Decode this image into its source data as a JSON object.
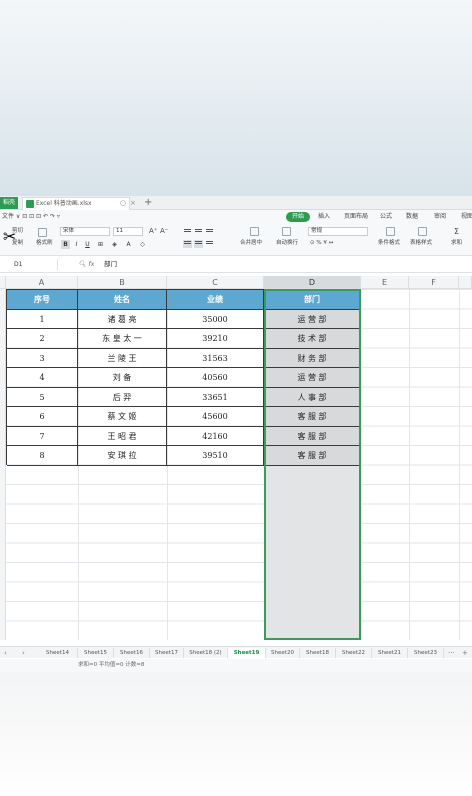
{
  "titlebar": {
    "app_tab": "稻壳",
    "file_tab": "Excel 科普动画.xlsx",
    "new_tab_symbol": "+"
  },
  "menubar": {
    "left_items": "文件 ∨ ⊡ ⊡ ⊡ ↶ ↷ ▿",
    "tabs": [
      {
        "label": "开始",
        "active": true
      },
      {
        "label": "插入",
        "active": false
      },
      {
        "label": "页面布局",
        "active": false
      },
      {
        "label": "公式",
        "active": false
      },
      {
        "label": "数据",
        "active": false
      },
      {
        "label": "审阅",
        "active": false
      },
      {
        "label": "视图",
        "active": false
      }
    ]
  },
  "ribbon": {
    "cut": "剪切",
    "paste": "粘贴",
    "copy": "复制",
    "format_painter": "格式刷",
    "font_name": "宋体",
    "font_size": "11",
    "bold": "B",
    "italic": "I",
    "underline": "U",
    "merge_center": "合并居中",
    "wrap_text": "自动换行",
    "number_format": "常规",
    "conditional_format": "条件格式",
    "table_style": "表格样式",
    "sum": "求和"
  },
  "formula_bar": {
    "cell_ref": "D1",
    "fx_label": "fx",
    "value": "部门"
  },
  "columns": [
    "A",
    "B",
    "C",
    "D",
    "E",
    "F"
  ],
  "selected_column": "D",
  "table": {
    "headers": [
      "序号",
      "姓名",
      "业绩",
      "部门"
    ],
    "rows": [
      [
        "1",
        "诸  葛  亮",
        "35000",
        "运  营  部"
      ],
      [
        "2",
        "东 皇 太 一",
        "39210",
        "技  术  部"
      ],
      [
        "3",
        "兰  陵  王",
        "31563",
        "财  务  部"
      ],
      [
        "4",
        "刘      备",
        "40560",
        "运  营  部"
      ],
      [
        "5",
        "后      羿",
        "33651",
        "人  事  部"
      ],
      [
        "6",
        "蔡  文  姬",
        "45600",
        "客  服  部"
      ],
      [
        "7",
        "王  昭  君",
        "42160",
        "客  服  部"
      ],
      [
        "8",
        "安  琪  拉",
        "39510",
        "客  服  部"
      ]
    ]
  },
  "sheets": [
    {
      "label": "Sheet14",
      "active": false
    },
    {
      "label": "Sheet15",
      "active": false
    },
    {
      "label": "Sheet16",
      "active": false
    },
    {
      "label": "Sheet17",
      "active": false
    },
    {
      "label": "Sheet18 (2)",
      "active": false
    },
    {
      "label": "Sheet19",
      "active": true
    },
    {
      "label": "Sheet20",
      "active": false
    },
    {
      "label": "Sheet18",
      "active": false
    },
    {
      "label": "Sheet22",
      "active": false
    },
    {
      "label": "Sheet21",
      "active": false
    },
    {
      "label": "Sheet23",
      "active": false
    }
  ],
  "status": "求和=0  平均值=0  计数=8",
  "colors": {
    "accent_green": "#2e9b53",
    "header_blue": "#5ea7d1",
    "dept_gray": "#d8d9db"
  }
}
